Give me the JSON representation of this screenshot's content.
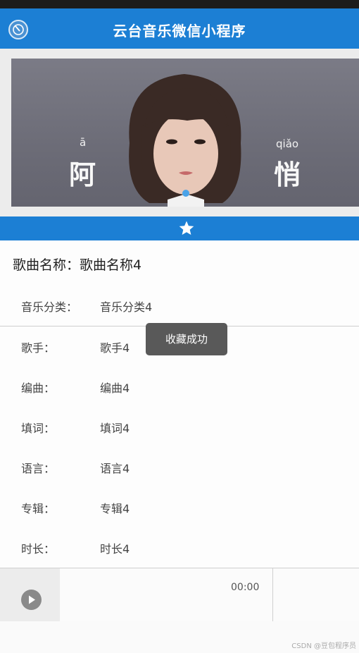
{
  "header": {
    "title": "云台音乐微信小程序",
    "back_icon": "back-circle-icon"
  },
  "banner": {
    "left_pinyin": "ā",
    "left_char": "阿",
    "right_pinyin": "qiǎo",
    "right_char": "悄",
    "accent_color": "#c0392b"
  },
  "action_bar": {
    "icon": "star-icon",
    "color": "#1c7fd4"
  },
  "song": {
    "name_label": "歌曲名称：",
    "name_value": "歌曲名称4",
    "details": [
      {
        "label": "音乐分类：",
        "value": "音乐分类4"
      },
      {
        "label": "歌手：",
        "value": "歌手4"
      },
      {
        "label": "编曲：",
        "value": "编曲4"
      },
      {
        "label": "填词：",
        "value": "填词4"
      },
      {
        "label": "语言：",
        "value": "语言4"
      },
      {
        "label": "专辑：",
        "value": "专辑4"
      },
      {
        "label": "时长：",
        "value": "时长4"
      }
    ]
  },
  "toast": {
    "text": "收藏成功"
  },
  "player": {
    "time": "00:00",
    "play_icon": "play-icon"
  },
  "watermark": "CSDN @豆包程序员"
}
